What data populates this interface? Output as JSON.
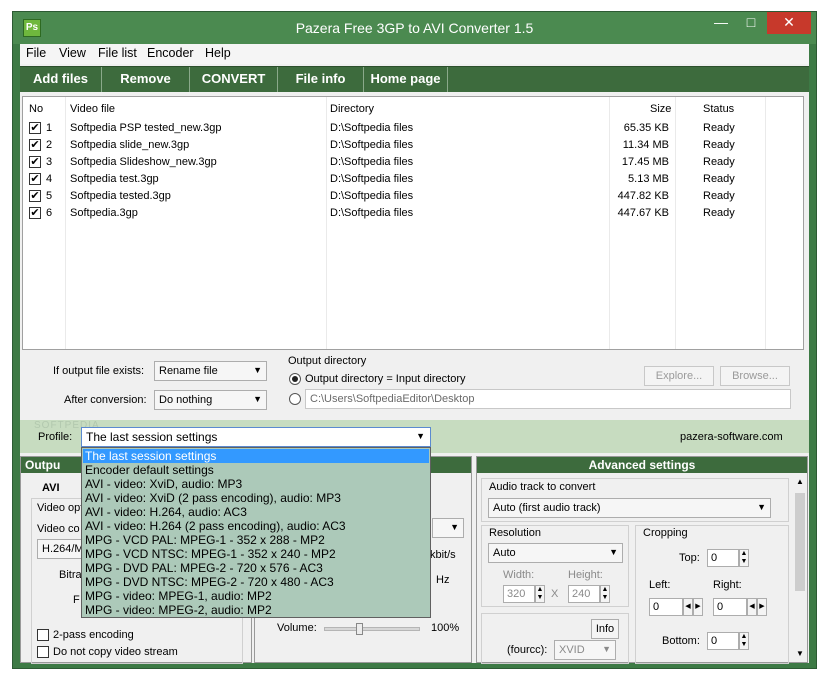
{
  "window": {
    "title": "Pazera Free 3GP to AVI Converter 1.5",
    "app_icon": "Ps",
    "min_glyph": "—",
    "max_glyph": "□",
    "close_glyph": "✕"
  },
  "menu": [
    "File",
    "View",
    "File list",
    "Encoder",
    "Help"
  ],
  "toolbar": [
    "Add files",
    "Remove",
    "CONVERT",
    "File info",
    "Home page"
  ],
  "grid": {
    "headers": {
      "no": "No",
      "video_file": "Video file",
      "directory": "Directory",
      "size": "Size",
      "status": "Status"
    },
    "rows": [
      {
        "checked": "✔",
        "no": "1",
        "file": "Softpedia PSP tested_new.3gp",
        "dir": "D:\\Softpedia files",
        "size": "65.35 KB",
        "status": "Ready"
      },
      {
        "checked": "✔",
        "no": "2",
        "file": "Softpedia slide_new.3gp",
        "dir": "D:\\Softpedia files",
        "size": "11.34 MB",
        "status": "Ready"
      },
      {
        "checked": "✔",
        "no": "3",
        "file": "Softpedia Slideshow_new.3gp",
        "dir": "D:\\Softpedia files",
        "size": "17.45 MB",
        "status": "Ready"
      },
      {
        "checked": "✔",
        "no": "4",
        "file": "Softpedia test.3gp",
        "dir": "D:\\Softpedia files",
        "size": "5.13 MB",
        "status": "Ready"
      },
      {
        "checked": "✔",
        "no": "5",
        "file": "Softpedia tested.3gp",
        "dir": "D:\\Softpedia files",
        "size": "447.82 KB",
        "status": "Ready"
      },
      {
        "checked": "✔",
        "no": "6",
        "file": "Softpedia.3gp",
        "dir": "D:\\Softpedia files",
        "size": "447.67 KB",
        "status": "Ready"
      }
    ]
  },
  "options": {
    "if_exists_label": "If output file exists:",
    "if_exists_value": "Rename file",
    "after_label": "After conversion:",
    "after_value": "Do nothing",
    "output_dir_label": "Output directory",
    "radio_same": "Output directory = Input directory",
    "custom_dir": "C:\\Users\\SoftpediaEditor\\Desktop",
    "explore_label": "Explore...",
    "browse_label": "Browse..."
  },
  "profile": {
    "label": "Profile:",
    "value": "The last session settings",
    "website": "pazera-software.com",
    "watermark": "SOFTPEDIA",
    "options": [
      "The last session settings",
      "Encoder default settings",
      "AVI - video: XviD, audio: MP3",
      "AVI - video: XviD (2 pass encoding), audio: MP3",
      "AVI - video: H.264, audio: AC3",
      "AVI - video: H.264 (2 pass encoding), audio: AC3",
      "MPG - VCD PAL: MPEG-1 - 352 x 288 - MP2",
      "MPG - VCD NTSC: MPEG-1 - 352 x 240 - MP2",
      "MPG - DVD PAL: MPEG-2 - 720 x 576 - AC3",
      "MPG - DVD NTSC: MPEG-2 - 720 x 480 - AC3",
      "MPG - video: MPEG-1, audio: MP2",
      "MPG - video: MPEG-2, audio: MP2"
    ]
  },
  "output_panel": {
    "title": "Outpu",
    "tab": "AVI",
    "video_opt": "Video opt",
    "video_codec": "Video co",
    "codec_value": "H.264/M",
    "bitrate": "Bitra",
    "fps": "F",
    "two_pass": "2-pass encoding",
    "no_copy": "Do not copy video stream"
  },
  "audio_panel": {
    "kbits": "kbit/s",
    "hz": "Hz",
    "volume_label": "Volume:",
    "volume_value": "100%",
    "volume_level": 0.35
  },
  "advanced": {
    "title": "Advanced settings",
    "audio_track_label": "Audio track to convert",
    "audio_track_value": "Auto (first audio track)",
    "resolution_label": "Resolution",
    "resolution_value": "Auto",
    "width_label": "Width:",
    "height_label": "Height:",
    "width_value": "320",
    "height_value": "240",
    "x_sep": "X",
    "info_label": "Info",
    "fourcc_label": "(fourcc):",
    "fourcc_value": "XVID",
    "cropping_label": "Cropping",
    "top_label": "Top:",
    "left_label": "Left:",
    "right_label": "Right:",
    "bottom_label": "Bottom:",
    "top_value": "0",
    "left_value": "0",
    "right_value": "0",
    "bottom_value": "0"
  }
}
